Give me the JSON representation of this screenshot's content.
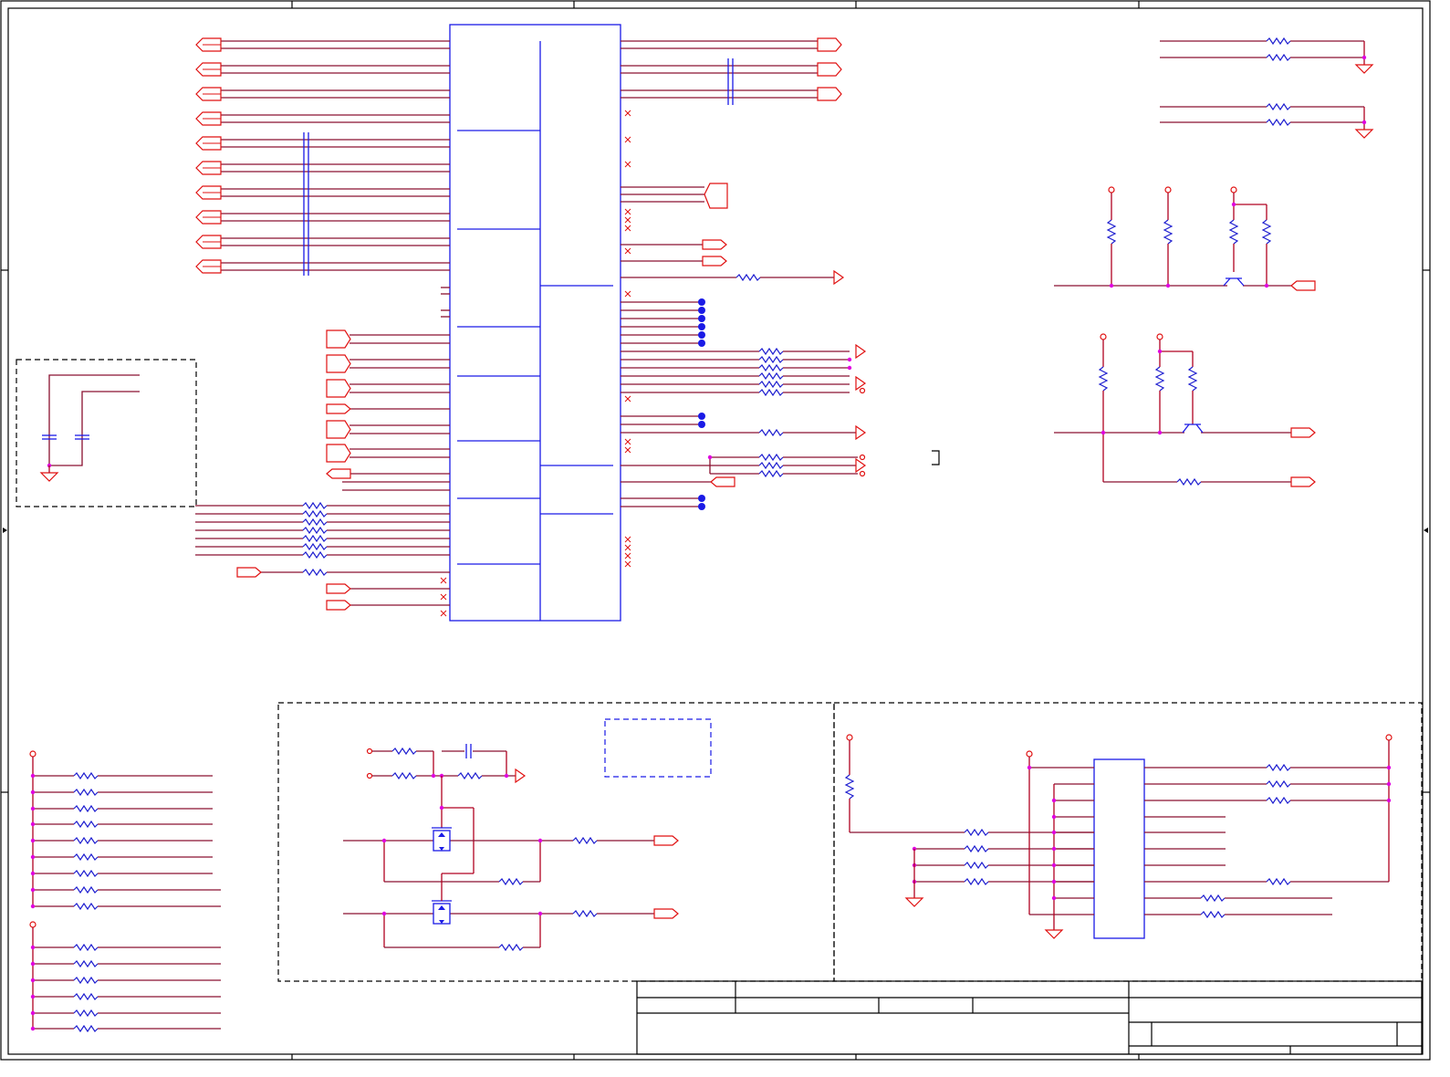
{
  "page": {
    "kind": "schematic-sheet",
    "background": "#ffffff",
    "colors": {
      "wire": "#b00020",
      "component": "#1a1ae6",
      "port": "#e01010",
      "junction": "#e000e0",
      "frame": "#000000"
    }
  },
  "icons": {
    "net_port": "pentagon-port",
    "power": "power-circle",
    "ground": "ground-triangle",
    "resistor": "zigzag-resistor",
    "capacitor": "parallel-plate-capacitor",
    "transistor": "npn-transistor",
    "mosfet": "mosfet",
    "no_connect": "x-mark"
  },
  "title_block": {
    "title": "",
    "size": "",
    "document_number": "",
    "revision": "",
    "date": "",
    "sheet": ""
  }
}
